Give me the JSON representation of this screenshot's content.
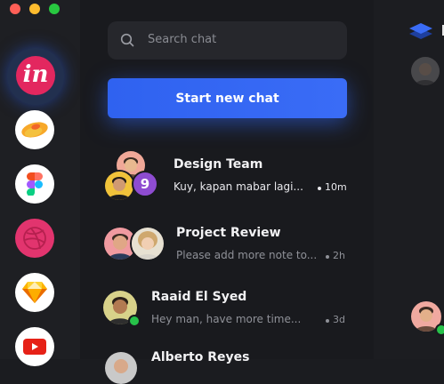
{
  "search": {
    "placeholder": "Search chat"
  },
  "start_button": {
    "label": "Start new chat"
  },
  "chats": [
    {
      "title": "Design Team",
      "preview": "Kuy, kapan mabar lagi...",
      "time": "10m",
      "member_count": "9",
      "unread": true
    },
    {
      "title": "Project Review",
      "preview": "Please add more note to...",
      "time": "2h",
      "unread": false
    },
    {
      "title": "Raaid El Syed",
      "preview": "Hey man, have more time...",
      "time": "3d",
      "unread": false,
      "online": true
    },
    {
      "title": "Alberto Reyes"
    }
  ],
  "rail_apps": [
    "invision-icon",
    "zeplin-icon",
    "figma-icon",
    "dribbble-icon",
    "sketch-icon",
    "youtube-icon"
  ],
  "rail_label": "in",
  "colors": {
    "accent": "#2f62f0",
    "online": "#27c24a",
    "badge": "#8e4cd1"
  }
}
